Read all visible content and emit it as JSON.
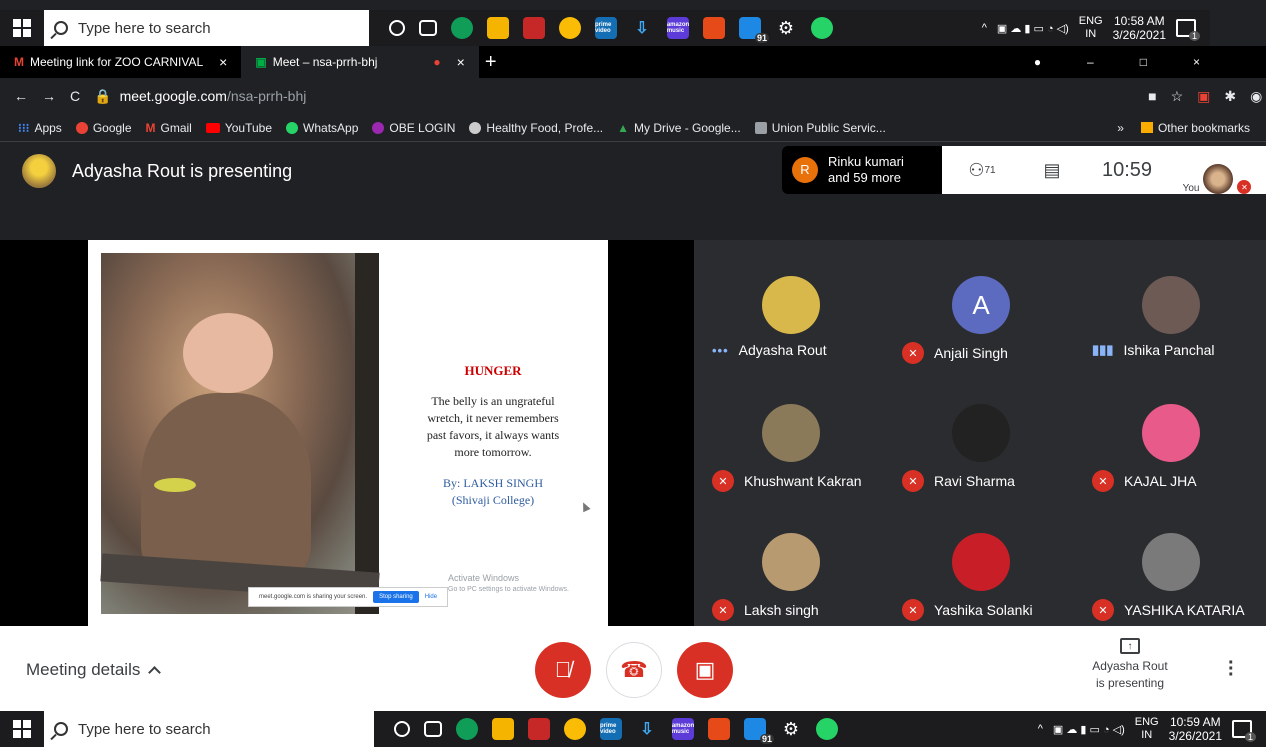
{
  "taskbar_top": {
    "search_placeholder": "Type here to search",
    "lang": "ENG",
    "region": "IN",
    "time": "10:58 AM",
    "date": "3/26/2021",
    "badge_count": "91",
    "notif_count": "1"
  },
  "taskbar_bottom": {
    "search_placeholder": "Type here to search",
    "lang": "ENG",
    "region": "IN",
    "time": "10:59 AM",
    "date": "3/26/2021",
    "badge_count": "91",
    "notif_count": "1"
  },
  "taskbar_apps": [
    "prime video",
    "amazon music"
  ],
  "browser": {
    "tabs": [
      {
        "title": "Meeting link for ZOO CARNIVAL",
        "icon": "gmail-icon"
      },
      {
        "title": "Meet – nsa-prrh-bhj",
        "icon": "meet-icon"
      }
    ],
    "url_host": "meet.google.com",
    "url_path": "/nsa-prrh-bhj",
    "bookmarks": [
      {
        "label": "Apps",
        "color": "#4285f4"
      },
      {
        "label": "Google",
        "color": "#ea4335"
      },
      {
        "label": "Gmail",
        "color": "#ea4335"
      },
      {
        "label": "YouTube",
        "color": "#ff0000"
      },
      {
        "label": "WhatsApp",
        "color": "#25d366"
      },
      {
        "label": "OBE LOGIN",
        "color": "#9c27b0"
      },
      {
        "label": "Healthy Food, Profe...",
        "color": "#cccccc"
      },
      {
        "label": "My Drive - Google...",
        "color": "#34a853"
      },
      {
        "label": "Union Public Servic...",
        "color": "#9aa0a6"
      }
    ],
    "bookmarks_overflow": "»",
    "other_bookmarks": "Other bookmarks"
  },
  "meet": {
    "presenting_banner": "Adyasha Rout is presenting",
    "rinku_initial": "R",
    "rinku_line1": "Rinku kumari",
    "rinku_line2": "and 59 more",
    "people_count": "71",
    "clock": "10:59",
    "you_label": "You"
  },
  "slide": {
    "title": "HUNGER",
    "poem": [
      "The belly is an ungrateful",
      "wretch, it never remembers",
      "past favors, it always wants",
      "more tomorrow."
    ],
    "byline1": "By: LAKSH SINGH",
    "byline2": "(Shivaji College)",
    "share_text": "meet.google.com is sharing your screen.",
    "stop_label": "Stop sharing",
    "hide_label": "Hide",
    "activate1": "Activate Windows",
    "activate2": "Go to PC settings to activate Windows."
  },
  "participants": [
    {
      "name": "Adyasha Rout",
      "status": "speaking-dots",
      "avatar_color": "#d8b84a",
      "initial": ""
    },
    {
      "name": "Anjali Singh",
      "status": "muted",
      "avatar_color": "#5c6bc0",
      "initial": "A"
    },
    {
      "name": "Ishika Panchal",
      "status": "speaking-bars",
      "avatar_color": "#6d5a55",
      "initial": ""
    },
    {
      "name": "Khushwant Kakran",
      "status": "muted",
      "avatar_color": "#8a7a5a",
      "initial": ""
    },
    {
      "name": "Ravi Sharma",
      "status": "muted",
      "avatar_color": "#222222",
      "initial": ""
    },
    {
      "name": "KAJAL JHA",
      "status": "muted",
      "avatar_color": "#e85a8a",
      "initial": ""
    },
    {
      "name": "Laksh singh",
      "status": "muted",
      "avatar_color": "#b89a70",
      "initial": ""
    },
    {
      "name": "Yashika Solanki",
      "status": "muted",
      "avatar_color": "#c81e28",
      "initial": ""
    },
    {
      "name": "YASHIKA KATARIA",
      "status": "muted",
      "avatar_color": "#7a7a7a",
      "initial": ""
    }
  ],
  "controls": {
    "meeting_details": "Meeting details",
    "presenting_line1": "Adyasha Rout",
    "presenting_line2": "is presenting"
  }
}
